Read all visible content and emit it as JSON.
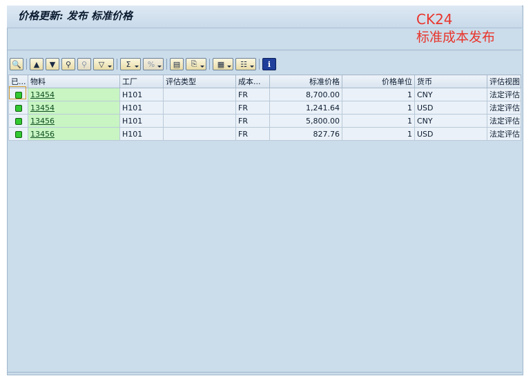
{
  "window": {
    "title": "价格更新: 发布 标准价格"
  },
  "annotation": {
    "line1": "CK24",
    "line2": "标准成本发布"
  },
  "toolbar": {
    "buttons": [
      {
        "icon": "details-icon",
        "glyph": "🔍"
      },
      {
        "icon": "sort-ascending-icon",
        "glyph": "▲"
      },
      {
        "icon": "sort-descending-icon",
        "glyph": "▼"
      },
      {
        "icon": "find-icon",
        "glyph": "⚲"
      },
      {
        "icon": "find-next-icon",
        "glyph": "⚲"
      },
      {
        "icon": "filter-icon",
        "glyph": "▽"
      },
      {
        "icon": "sum-icon",
        "glyph": "Σ"
      },
      {
        "icon": "subtotal-icon",
        "glyph": "%"
      },
      {
        "icon": "print-preview-icon",
        "glyph": "▤"
      },
      {
        "icon": "export-icon",
        "glyph": "⎘"
      },
      {
        "icon": "change-layout-icon",
        "glyph": "▦"
      },
      {
        "icon": "select-layout-icon",
        "glyph": "☷"
      },
      {
        "icon": "information-icon",
        "glyph": "i"
      }
    ]
  },
  "table": {
    "headers": [
      "已...",
      "物料",
      "工厂",
      "评估类型",
      "成本...",
      "标准价格",
      "价格单位",
      "货币",
      "评估视图"
    ],
    "rows": [
      {
        "material": "13454",
        "plant": "H101",
        "valuation_type": "",
        "cost": "FR",
        "std_price": "8,700.00",
        "price_unit": "1",
        "currency": "CNY",
        "view": "法定评估"
      },
      {
        "material": "13454",
        "plant": "H101",
        "valuation_type": "",
        "cost": "FR",
        "std_price": "1,241.64",
        "price_unit": "1",
        "currency": "USD",
        "view": "法定评估"
      },
      {
        "material": "13456",
        "plant": "H101",
        "valuation_type": "",
        "cost": "FR",
        "std_price": "5,800.00",
        "price_unit": "1",
        "currency": "CNY",
        "view": "法定评估"
      },
      {
        "material": "13456",
        "plant": "H101",
        "valuation_type": "",
        "cost": "FR",
        "std_price": "827.76",
        "price_unit": "1",
        "currency": "USD",
        "view": "法定评估"
      }
    ]
  },
  "colors": {
    "status_green": "#32c932",
    "material_bg": "#c8f5c2",
    "annotation_red": "#e8352c",
    "frame_bg": "#cbdcea"
  }
}
